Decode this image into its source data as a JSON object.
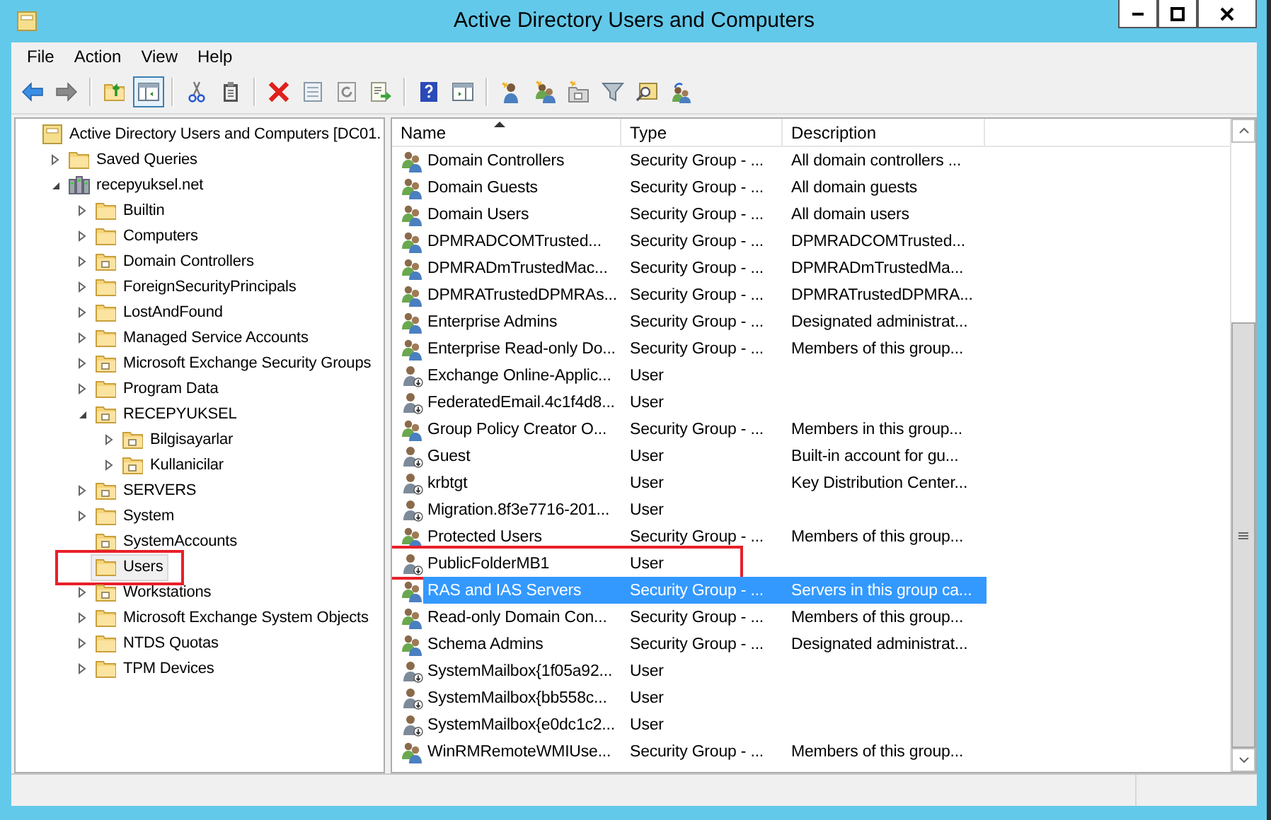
{
  "window": {
    "title": "Active Directory Users and Computers"
  },
  "menu": [
    "File",
    "Action",
    "View",
    "Help"
  ],
  "toolbar": [
    {
      "kind": "back",
      "pressed": false
    },
    {
      "kind": "forward",
      "pressed": false
    },
    {
      "kind": "separator",
      "pressed": false
    },
    {
      "kind": "up",
      "pressed": false
    },
    {
      "kind": "tree-pane",
      "pressed": true
    },
    {
      "kind": "separator",
      "pressed": false
    },
    {
      "kind": "cut",
      "pressed": false
    },
    {
      "kind": "paste",
      "pressed": false
    },
    {
      "kind": "separator",
      "pressed": false
    },
    {
      "kind": "delete",
      "pressed": false
    },
    {
      "kind": "properties",
      "pressed": false
    },
    {
      "kind": "refresh",
      "pressed": false
    },
    {
      "kind": "export",
      "pressed": false
    },
    {
      "kind": "separator",
      "pressed": false
    },
    {
      "kind": "help",
      "pressed": false
    },
    {
      "kind": "action-pane",
      "pressed": false
    },
    {
      "kind": "separator",
      "pressed": false
    },
    {
      "kind": "new-user",
      "pressed": false
    },
    {
      "kind": "new-group",
      "pressed": false
    },
    {
      "kind": "new-ou",
      "pressed": false
    },
    {
      "kind": "filter",
      "pressed": false
    },
    {
      "kind": "find",
      "pressed": false
    },
    {
      "kind": "add-group",
      "pressed": false
    }
  ],
  "tree": [
    {
      "label": "Active Directory Users and Computers [DC01.",
      "kind": "root",
      "expandable": false,
      "selected": false,
      "highlighted": false,
      "children": [
        {
          "label": "Saved Queries",
          "kind": "folder",
          "expandable": true,
          "expanded": false,
          "selected": false,
          "highlighted": false
        },
        {
          "label": "recepyuksel.net",
          "kind": "domain",
          "expandable": true,
          "expanded": true,
          "selected": false,
          "highlighted": false,
          "children": [
            {
              "label": "Builtin",
              "kind": "folder",
              "expandable": true,
              "expanded": false,
              "selected": false,
              "highlighted": false
            },
            {
              "label": "Computers",
              "kind": "folder",
              "expandable": true,
              "expanded": false,
              "selected": false,
              "highlighted": false
            },
            {
              "label": "Domain Controllers",
              "kind": "ou",
              "expandable": true,
              "expanded": false,
              "selected": false,
              "highlighted": false
            },
            {
              "label": "ForeignSecurityPrincipals",
              "kind": "folder",
              "expandable": true,
              "expanded": false,
              "selected": false,
              "highlighted": false
            },
            {
              "label": "LostAndFound",
              "kind": "folder",
              "expandable": true,
              "expanded": false,
              "selected": false,
              "highlighted": false
            },
            {
              "label": "Managed Service Accounts",
              "kind": "folder",
              "expandable": true,
              "expanded": false,
              "selected": false,
              "highlighted": false
            },
            {
              "label": "Microsoft Exchange Security Groups",
              "kind": "ou",
              "expandable": true,
              "expanded": false,
              "selected": false,
              "highlighted": false
            },
            {
              "label": "Program Data",
              "kind": "folder",
              "expandable": true,
              "expanded": false,
              "selected": false,
              "highlighted": false
            },
            {
              "label": "RECEPYUKSEL",
              "kind": "ou",
              "expandable": true,
              "expanded": true,
              "selected": false,
              "highlighted": false,
              "children": [
                {
                  "label": "Bilgisayarlar",
                  "kind": "ou",
                  "expandable": true,
                  "expanded": false,
                  "selected": false,
                  "highlighted": false
                },
                {
                  "label": "Kullanicilar",
                  "kind": "ou",
                  "expandable": true,
                  "expanded": false,
                  "selected": false,
                  "highlighted": false
                }
              ]
            },
            {
              "label": "SERVERS",
              "kind": "ou",
              "expandable": true,
              "expanded": false,
              "selected": false,
              "highlighted": false
            },
            {
              "label": "System",
              "kind": "folder",
              "expandable": true,
              "expanded": false,
              "selected": false,
              "highlighted": false
            },
            {
              "label": "SystemAccounts",
              "kind": "ou",
              "expandable": false,
              "selected": false,
              "highlighted": false
            },
            {
              "label": "Users",
              "kind": "folder",
              "expandable": false,
              "selected": true,
              "highlighted": true
            },
            {
              "label": "Workstations",
              "kind": "ou",
              "expandable": true,
              "expanded": false,
              "selected": false,
              "highlighted": false
            },
            {
              "label": "Microsoft Exchange System Objects",
              "kind": "folder",
              "expandable": true,
              "expanded": false,
              "selected": false,
              "highlighted": false
            },
            {
              "label": "NTDS Quotas",
              "kind": "folder",
              "expandable": true,
              "expanded": false,
              "selected": false,
              "highlighted": false
            },
            {
              "label": "TPM Devices",
              "kind": "folder",
              "expandable": true,
              "expanded": false,
              "selected": false,
              "highlighted": false
            }
          ]
        }
      ]
    }
  ],
  "table": {
    "columns": [
      {
        "label": "Name",
        "sorted": true
      },
      {
        "label": "Type",
        "sorted": false
      },
      {
        "label": "Description",
        "sorted": false
      }
    ],
    "rows": [
      {
        "name": "Domain Controllers",
        "type": "Security Group - ...",
        "description": "All domain controllers ...",
        "kind": "group",
        "selected": false,
        "highlighted": false
      },
      {
        "name": "Domain Guests",
        "type": "Security Group - ...",
        "description": "All domain guests",
        "kind": "group",
        "selected": false,
        "highlighted": false
      },
      {
        "name": "Domain Users",
        "type": "Security Group - ...",
        "description": "All domain users",
        "kind": "group",
        "selected": false,
        "highlighted": false
      },
      {
        "name": "DPMRADCOMTrusted...",
        "type": "Security Group - ...",
        "description": "DPMRADCOMTrusted...",
        "kind": "group",
        "selected": false,
        "highlighted": false
      },
      {
        "name": "DPMRADmTrustedMac...",
        "type": "Security Group - ...",
        "description": "DPMRADmTrustedMa...",
        "kind": "group",
        "selected": false,
        "highlighted": false
      },
      {
        "name": "DPMRATrustedDPMRAs...",
        "type": "Security Group - ...",
        "description": "DPMRATrustedDPMRA...",
        "kind": "group",
        "selected": false,
        "highlighted": false
      },
      {
        "name": "Enterprise Admins",
        "type": "Security Group - ...",
        "description": "Designated administrat...",
        "kind": "group",
        "selected": false,
        "highlighted": false
      },
      {
        "name": "Enterprise Read-only Do...",
        "type": "Security Group - ...",
        "description": "Members of this group...",
        "kind": "group",
        "selected": false,
        "highlighted": false
      },
      {
        "name": "Exchange Online-Applic...",
        "type": "User",
        "kind": "user",
        "selected": false,
        "highlighted": false
      },
      {
        "name": "FederatedEmail.4c1f4d8...",
        "type": "User",
        "kind": "user",
        "selected": false,
        "highlighted": false
      },
      {
        "name": "Group Policy Creator O...",
        "type": "Security Group - ...",
        "description": "Members in this group...",
        "kind": "group",
        "selected": false,
        "highlighted": false
      },
      {
        "name": "Guest",
        "type": "User",
        "description": "Built-in account for gu...",
        "kind": "user",
        "selected": false,
        "highlighted": false
      },
      {
        "name": "krbtgt",
        "type": "User",
        "description": "Key Distribution Center...",
        "kind": "user",
        "selected": false,
        "highlighted": false
      },
      {
        "name": "Migration.8f3e7716-201...",
        "type": "User",
        "kind": "user",
        "selected": false,
        "highlighted": false
      },
      {
        "name": "Protected Users",
        "type": "Security Group - ...",
        "description": "Members of this group...",
        "kind": "group",
        "selected": false,
        "highlighted": false
      },
      {
        "name": "PublicFolderMB1",
        "type": "User",
        "kind": "user",
        "selected": false,
        "highlighted": true
      },
      {
        "name": "RAS and IAS Servers",
        "type": "Security Group - ...",
        "description": "Servers in this group ca...",
        "kind": "group",
        "selected": true,
        "highlighted": false
      },
      {
        "name": "Read-only Domain Con...",
        "type": "Security Group - ...",
        "description": "Members of this group...",
        "kind": "group",
        "selected": false,
        "highlighted": false
      },
      {
        "name": "Schema Admins",
        "type": "Security Group - ...",
        "description": "Designated administrat...",
        "kind": "group",
        "selected": false,
        "highlighted": false
      },
      {
        "name": "SystemMailbox{1f05a92...",
        "type": "User",
        "kind": "user",
        "selected": false,
        "highlighted": false
      },
      {
        "name": "SystemMailbox{bb558c...",
        "type": "User",
        "kind": "user",
        "selected": false,
        "highlighted": false
      },
      {
        "name": "SystemMailbox{e0dc1c2...",
        "type": "User",
        "kind": "user",
        "selected": false,
        "highlighted": false
      },
      {
        "name": "WinRMRemoteWMIUse...",
        "type": "Security Group - ...",
        "description": "Members of this group...",
        "kind": "group",
        "selected": false,
        "highlighted": false
      }
    ]
  }
}
